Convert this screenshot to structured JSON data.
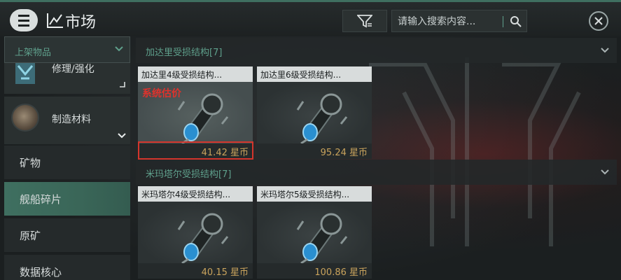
{
  "header": {
    "title": "市场",
    "search_placeholder": "请输入搜索内容...",
    "icons": [
      "menu-icon",
      "chart-icon",
      "filter-icon",
      "search-icon",
      "close-icon"
    ]
  },
  "left_panel": {
    "header_label": "上架物品",
    "categories": [
      {
        "label": "修理/强化",
        "icon": "upgrade-module-icon"
      },
      {
        "label": "制造材料",
        "icon": "ore-material-icon"
      }
    ],
    "sub_items": [
      {
        "label": "矿物"
      },
      {
        "label": "舰船碎片"
      },
      {
        "label": "原矿"
      },
      {
        "label": "数据核心"
      }
    ],
    "active_sub_item": "舰船碎片"
  },
  "sections": [
    {
      "title": "加达里受损结构[7]",
      "items": [
        {
          "name": "加达里4级受损结构...",
          "price": "41.42 星币",
          "tag": "系统估价"
        },
        {
          "name": "加达里6级受损结构...",
          "price": "95.24 星币"
        }
      ]
    },
    {
      "title": "米玛塔尔受损结构[7]",
      "items": [
        {
          "name": "米玛塔尔4级受损结构...",
          "price": "40.15 星币"
        },
        {
          "name": "米玛塔尔5级受损结构...",
          "price": "100.86 星币"
        }
      ]
    }
  ],
  "colors": {
    "accent": "#5fa08c",
    "price": "#c9a35c",
    "highlight": "#d4352c"
  }
}
